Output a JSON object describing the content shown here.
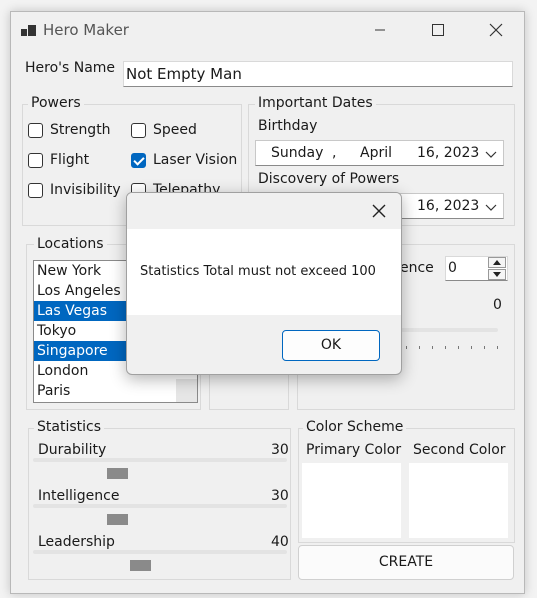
{
  "window": {
    "title": "Hero Maker"
  },
  "hero_name": {
    "label": "Hero's Name",
    "value": "Not Empty Man"
  },
  "powers": {
    "label": "Powers",
    "items": [
      {
        "label": "Strength",
        "checked": false
      },
      {
        "label": "Speed",
        "checked": false
      },
      {
        "label": "Flight",
        "checked": false
      },
      {
        "label": "Laser Vision",
        "checked": true
      },
      {
        "label": "Invisibility",
        "checked": false
      },
      {
        "label": "Telepathy",
        "checked": false
      }
    ]
  },
  "dates": {
    "label": "Important Dates",
    "birthday_label": "Birthday",
    "birthday": {
      "weekday": "Sunday",
      "sep": ",",
      "month": "April",
      "day_year": "16, 2023"
    },
    "discovery_label": "Discovery of Powers",
    "discovery": {
      "day_year": "16, 2023"
    }
  },
  "locations": {
    "label": "Locations",
    "items": [
      {
        "label": "New York",
        "selected": false
      },
      {
        "label": "Los Angeles",
        "selected": false
      },
      {
        "label": "Las Vegas",
        "selected": true
      },
      {
        "label": "Tokyo",
        "selected": false
      },
      {
        "label": "Singapore",
        "selected": true
      },
      {
        "label": "London",
        "selected": false
      },
      {
        "label": "Paris",
        "selected": false
      }
    ]
  },
  "middle": {
    "partial_label": "ence",
    "numeric_value": "0",
    "slider_value": "0"
  },
  "statistics": {
    "label": "Statistics",
    "items": [
      {
        "label": "Durability",
        "value": "30",
        "level": 30
      },
      {
        "label": "Intelligence",
        "value": "30",
        "level": 30
      },
      {
        "label": "Leadership",
        "value": "40",
        "level": 40
      }
    ]
  },
  "color_scheme": {
    "label": "Color Scheme",
    "primary_label": "Primary Color",
    "secondary_label": "Second Color"
  },
  "create_button": "CREATE",
  "dialog": {
    "message": "Statistics Total must not exceed 100",
    "ok": "OK"
  },
  "colors": {
    "accent": "#0067c0",
    "window_bg": "#f0f0f0"
  }
}
